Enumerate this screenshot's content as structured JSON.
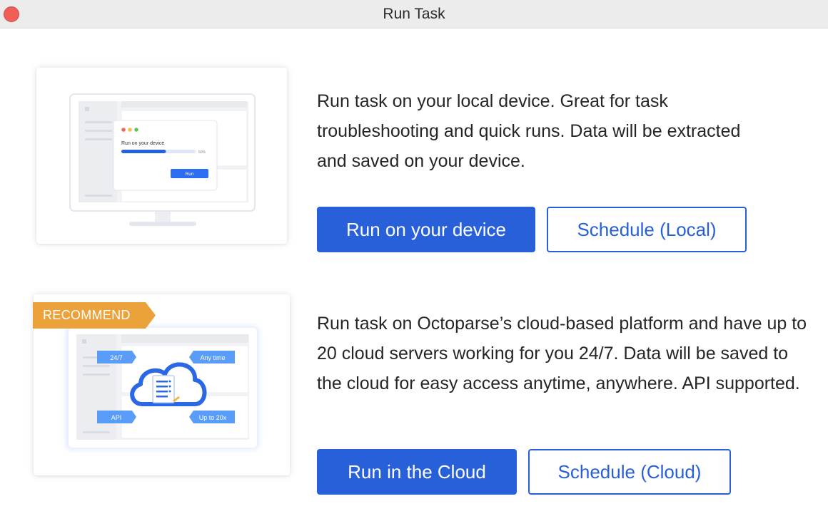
{
  "window": {
    "title": "Run Task"
  },
  "local": {
    "illustration": {
      "dialog_title": "Run on your device",
      "progress_percent": 60,
      "progress_label": "60%",
      "run_button_label": "Run"
    },
    "description": "Run task on your local device. Great for task troubleshooting and quick runs. Data will be extracted and saved on your device.",
    "run_button": "Run on your device",
    "schedule_button": "Schedule (Local)"
  },
  "cloud": {
    "badge": "RECOMMEND",
    "illustration": {
      "tag_247": "24/7",
      "tag_anytime": "Any time",
      "tag_api": "API",
      "tag_upto": "Up to 20x"
    },
    "description": "Run task on Octoparse’s cloud-based platform and have up to 20 cloud servers working for you 24/7. Data will be saved to the cloud for easy access anytime, anywhere. API supported.",
    "run_button": "Run in the Cloud",
    "schedule_button": "Schedule (Cloud)"
  },
  "colors": {
    "primary": "#2860d9",
    "badge": "#eba23a",
    "close_button": "#ee5f57",
    "tag_blue": "#5a9df8"
  }
}
